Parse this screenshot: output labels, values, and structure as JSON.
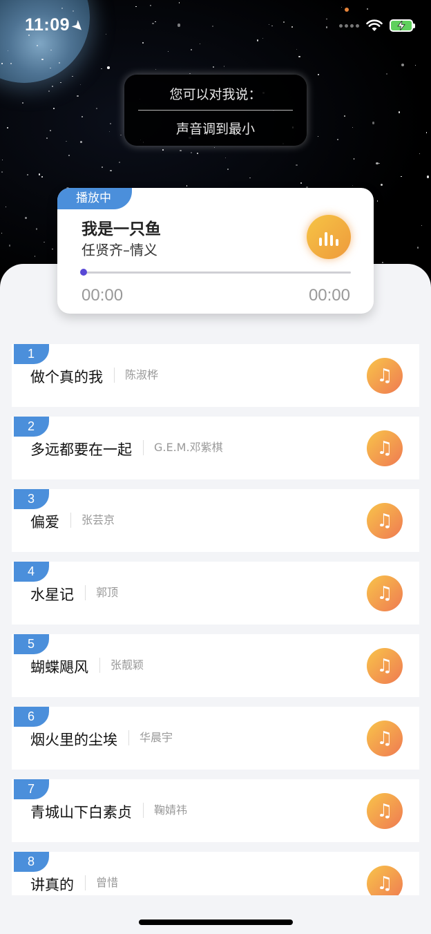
{
  "status_bar": {
    "time": "11:09",
    "location_icon": "location-arrow-icon",
    "wifi_icon": "wifi-icon",
    "battery_icon": "battery-charging-icon"
  },
  "voice_hint": {
    "title": "您可以对我说：",
    "phrase": "声音调到最小"
  },
  "now_playing": {
    "tag": "播放中",
    "title": "我是一只鱼",
    "subtitle": "任贤齐–情义",
    "current_time": "00:00",
    "total_time": "00:00",
    "progress": 0,
    "button_icon": "equalizer-icon"
  },
  "songs": [
    {
      "num": "1",
      "title": "做个真的我",
      "artist": "陈淑桦"
    },
    {
      "num": "2",
      "title": "多远都要在一起",
      "artist": "G.E.M.邓紫棋"
    },
    {
      "num": "3",
      "title": "偏爱",
      "artist": "张芸京"
    },
    {
      "num": "4",
      "title": "水星记",
      "artist": "郭顶"
    },
    {
      "num": "5",
      "title": "蝴蝶飓风",
      "artist": "张靓颖"
    },
    {
      "num": "6",
      "title": "烟火里的尘埃",
      "artist": "华晨宇"
    },
    {
      "num": "7",
      "title": "青城山下白素贞",
      "artist": "鞠婧祎"
    },
    {
      "num": "8",
      "title": "讲真的",
      "artist": "曾惜"
    }
  ],
  "song_button_icon": "music-note-icon",
  "colors": {
    "accent_blue": "#4b8fdb",
    "progress": "#5848d6",
    "orange_start": "#f6c445",
    "orange_end": "#ef7a52"
  }
}
